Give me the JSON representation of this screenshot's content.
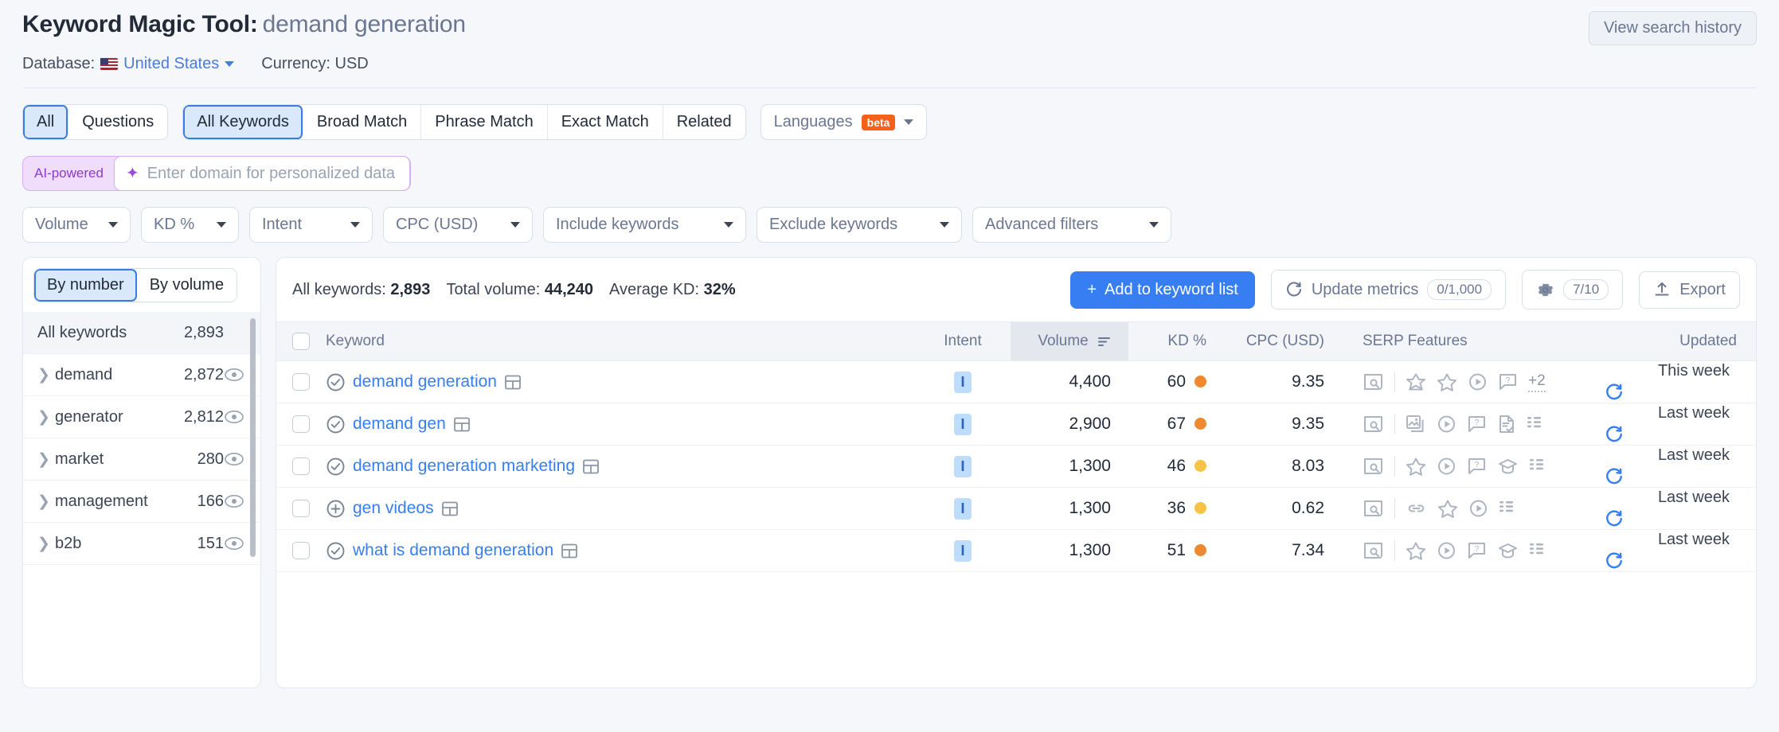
{
  "header": {
    "title": "Keyword Magic Tool:",
    "subject": "demand generation",
    "view_history": "View search history",
    "database_label": "Database:",
    "database_value": "United States",
    "currency": "Currency: USD",
    "flag_icon": "us-flag-icon"
  },
  "tabs": {
    "group1": [
      {
        "label": "All",
        "active": true
      },
      {
        "label": "Questions",
        "active": false
      }
    ],
    "group2": [
      {
        "label": "All Keywords",
        "active": true
      },
      {
        "label": "Broad Match",
        "active": false
      },
      {
        "label": "Phrase Match",
        "active": false
      },
      {
        "label": "Exact Match",
        "active": false
      },
      {
        "label": "Related",
        "active": false
      }
    ],
    "languages": {
      "label": "Languages",
      "badge": "beta"
    }
  },
  "ai_bar": {
    "label": "AI-powered",
    "placeholder": "Enter domain for personalized data",
    "value": ""
  },
  "filters": [
    {
      "label": "Volume"
    },
    {
      "label": "KD %"
    },
    {
      "label": "Intent"
    },
    {
      "label": "CPC (USD)"
    },
    {
      "label": "Include keywords"
    },
    {
      "label": "Exclude keywords"
    },
    {
      "label": "Advanced filters"
    }
  ],
  "sidebar": {
    "switch": [
      {
        "label": "By number",
        "active": true
      },
      {
        "label": "By volume",
        "active": false
      }
    ],
    "all_row": {
      "label": "All keywords",
      "count": "2,893"
    },
    "items": [
      {
        "label": "demand",
        "count": "2,872"
      },
      {
        "label": "generator",
        "count": "2,812"
      },
      {
        "label": "market",
        "count": "280"
      },
      {
        "label": "management",
        "count": "166"
      },
      {
        "label": "b2b",
        "count": "151"
      }
    ]
  },
  "summary": {
    "all_keywords_label": "All keywords:",
    "all_keywords_value": "2,893",
    "total_volume_label": "Total volume:",
    "total_volume_value": "44,240",
    "average_kd_label": "Average KD:",
    "average_kd_value": "32%",
    "add_button": "Add to keyword list",
    "update_metrics": "Update metrics",
    "update_metrics_count": "0/1,000",
    "settings_count": "7/10",
    "export": "Export"
  },
  "table": {
    "columns": {
      "keyword": "Keyword",
      "intent": "Intent",
      "volume": "Volume",
      "kd": "KD %",
      "cpc": "CPC (USD)",
      "serp": "SERP Features",
      "updated": "Updated"
    },
    "rows": [
      {
        "keyword": "demand generation",
        "kw_icon": "check-circle-icon",
        "intent": "I",
        "volume": "4,400",
        "kd": "60",
        "kd_color": "#f0882e",
        "cpc": "9.35",
        "serp": [
          "serp-preview-icon",
          "sep",
          "featured-snippet-icon",
          "reviews-icon",
          "video-icon",
          "faq-icon"
        ],
        "serp_more": "+2",
        "updated": "This week"
      },
      {
        "keyword": "demand gen",
        "kw_icon": "check-circle-icon",
        "intent": "I",
        "volume": "2,900",
        "kd": "67",
        "kd_color": "#f0882e",
        "cpc": "9.35",
        "serp": [
          "serp-preview-icon",
          "sep",
          "image-pack-icon",
          "video-icon",
          "faq-icon",
          "instant-answer-icon",
          "people-also-ask-icon"
        ],
        "serp_more": "",
        "updated": "Last week"
      },
      {
        "keyword": "demand generation marketing",
        "kw_icon": "check-circle-icon",
        "intent": "I",
        "volume": "1,300",
        "kd": "46",
        "kd_color": "#f5c councils"
      }
    ]
  }
}
